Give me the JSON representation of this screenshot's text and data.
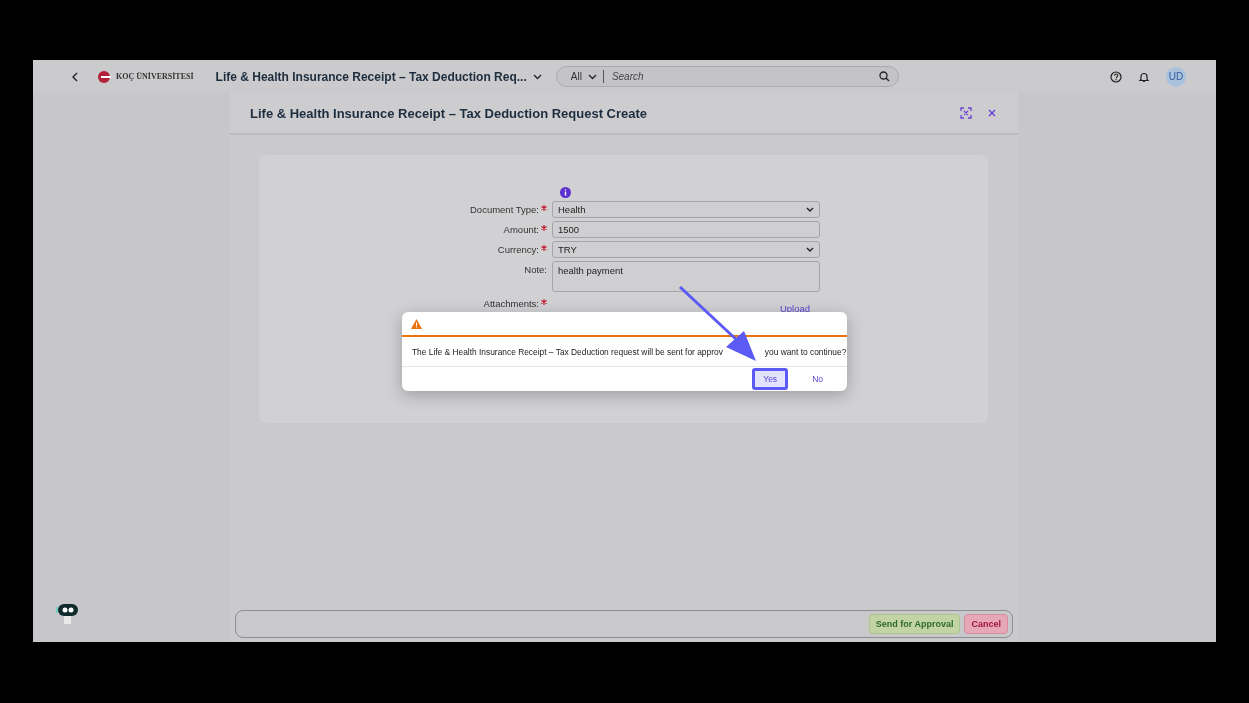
{
  "shell": {
    "logo_text": "KOÇ ÜNİVERSİTESİ",
    "app_title": "Life & Health Insurance Receipt – Tax Deduction Req...",
    "search": {
      "scope": "All",
      "placeholder": "Search"
    },
    "avatar": "UD"
  },
  "page": {
    "title": "Life & Health Insurance Receipt – Tax Deduction Request Create"
  },
  "form": {
    "fields": [
      {
        "kind": "select",
        "label": "Document Type:",
        "required": true,
        "value": "Health"
      },
      {
        "kind": "input",
        "label": "Amount:",
        "required": true,
        "value": "1500"
      },
      {
        "kind": "select",
        "label": "Currency:",
        "required": true,
        "value": "TRY"
      },
      {
        "kind": "textarea",
        "label": "Note:",
        "required": false,
        "value": "health payment"
      },
      {
        "kind": "upload",
        "label": "Attachments:",
        "required": true,
        "value": "Upload"
      }
    ]
  },
  "dialog": {
    "message_start": "The Life & Health Insurance Receipt – Tax Deduction request will be sent for approv",
    "message_end": "you want to continue?",
    "buttons": [
      {
        "label": "Yes",
        "highlighted": true
      },
      {
        "label": "No",
        "highlighted": false
      }
    ]
  },
  "footer": {
    "buttons": [
      {
        "kind": "accept",
        "label": "Send for Approval"
      },
      {
        "kind": "reject",
        "label": "Cancel"
      }
    ]
  }
}
